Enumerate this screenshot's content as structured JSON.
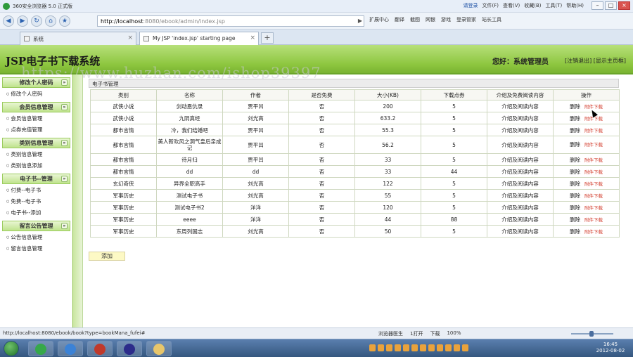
{
  "browser": {
    "window_title": "360安全浏览器 5.0 正式版",
    "menus": [
      "文件(F)",
      "查看(V)",
      "收藏(B)",
      "工具(T)",
      "帮助(H)"
    ],
    "login_text": "请登录",
    "address_host": "http://localhost",
    "address_rest": ":8080/ebook/admin/index.jsp",
    "toolbar_items": [
      "扩展中心",
      "翻译",
      "截图",
      "网银",
      "游戏",
      "登录管家",
      "站长工具"
    ],
    "tabs": [
      {
        "label": "系统",
        "active": false
      },
      {
        "label": "My JSP 'index.jsp' starting page",
        "active": true
      }
    ],
    "new_tab": "+"
  },
  "header": {
    "title": "JSP电子书下载系统",
    "welcome": "您好：系统管理员",
    "logout": "[注销退出]",
    "home": "[显示主页框]"
  },
  "watermark": "https://www.huzhan.com/ishop39397",
  "sidebar": {
    "groups": [
      {
        "title": "修改个人密码",
        "items": [
          "修改个人密码"
        ]
      },
      {
        "title": "会员信息管理",
        "items": [
          "会员信息管理",
          "点券充值管理"
        ]
      },
      {
        "title": "类别信息管理",
        "items": [
          "类别信息管理",
          "类别信息添加"
        ]
      },
      {
        "title": "电子书--管理",
        "items": [
          "付费--电子书",
          "免费--电子书",
          "电子书--添加"
        ]
      },
      {
        "title": "留言公告管理",
        "items": [
          "公告信息管理",
          "留言信息管理"
        ]
      }
    ]
  },
  "main": {
    "panel_title": "电子书管理",
    "columns": [
      "类别",
      "名称",
      "作者",
      "是否免费",
      "大小(KB)",
      "下载点券",
      "介绍及免费阅读内容",
      "操作"
    ],
    "rows": [
      [
        "武侠小说",
        "剑动恩仇录",
        "贾平凹",
        "否",
        "200",
        "5",
        "介绍及阅读内容"
      ],
      [
        "武侠小说",
        "九阴真经",
        "刘光高",
        "否",
        "633.2",
        "5",
        "介绍及阅读内容"
      ],
      [
        "都市言情",
        "冷，我们结婚吧",
        "贾平凹",
        "否",
        "55.3",
        "5",
        "介绍及阅读内容"
      ],
      [
        "都市言情",
        "美人新欢风之洞气皇后亲成记",
        "贾平凹",
        "否",
        "56.2",
        "5",
        "介绍及阅读内容"
      ],
      [
        "都市言情",
        "待月归",
        "贾平凹",
        "否",
        "33",
        "5",
        "介绍及阅读内容"
      ],
      [
        "都市言情",
        "dd",
        "dd",
        "否",
        "33",
        "44",
        "介绍及阅读内容"
      ],
      [
        "玄幻奇侠",
        "异界全职高手",
        "刘光高",
        "否",
        "122",
        "5",
        "介绍及阅读内容"
      ],
      [
        "军事历史",
        "测试电子书",
        "刘光高",
        "否",
        "55",
        "5",
        "介绍及阅读内容"
      ],
      [
        "军事历史",
        "测试电子书2",
        "洋洋",
        "否",
        "120",
        "5",
        "介绍及阅读内容"
      ],
      [
        "军事历史",
        "eeee",
        "洋洋",
        "否",
        "44",
        "88",
        "介绍及阅读内容"
      ],
      [
        "军事历史",
        "东周列国志",
        "刘光高",
        "否",
        "50",
        "5",
        "介绍及阅读内容"
      ]
    ],
    "action_delete": "删除",
    "action_download": "附件下载",
    "add_button": "添加"
  },
  "statusbar": {
    "url": "http://localhost:8080/ebook/book?type=bookMana_fufei#",
    "items": [
      "浏览器医生",
      "1打开",
      "下载",
      "100%"
    ]
  },
  "taskbar": {
    "time": "16:45",
    "date": "2012-08-02"
  }
}
